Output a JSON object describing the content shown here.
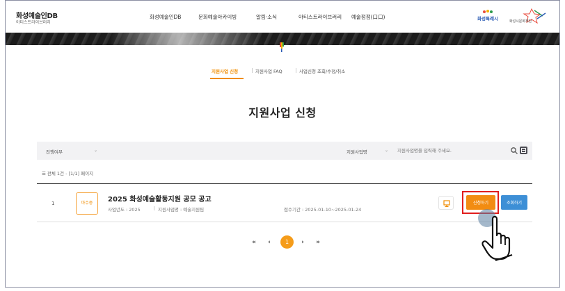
{
  "header": {
    "logo_title": "화성예술인DB",
    "logo_subtitle": "아티스트라이브러리",
    "nav": [
      "화성예술인DB",
      "문화예술아카이빙",
      "알림·소식",
      "아티스트라이브러리",
      "예술점점(口口)"
    ],
    "brand_left": "화성특례시",
    "brand_right": "화성시문화재단"
  },
  "subnav": {
    "tabs": [
      "지원사업 신청",
      "지원사업 FAQ",
      "사업신청 조회/수정/취소"
    ],
    "active_index": 0
  },
  "page_title": "지원사업 신청",
  "filter": {
    "status_label": "진행여부",
    "type_label": "지원사업명",
    "search_placeholder": "지원사업명을 입력해 주세요."
  },
  "count_text": "☰ 전체 1건 - [1/1] 페이지",
  "list": [
    {
      "num": "1",
      "status": "마수중",
      "title": "2025 화성예술활동지원 공모 공고",
      "year_label": "사업년도 : 2025",
      "field_label": "지원사업명 : 예술지원팀",
      "period": "접수기간 : 2025-01-10~2025-01-24",
      "apply_label": "신청하기",
      "lookup_label": "조회하기"
    }
  ],
  "pagination": {
    "first": "«",
    "prev": "‹",
    "current": "1",
    "next": "›",
    "last": "»"
  },
  "colors": {
    "accent": "#f08c00",
    "apply": "#f28c12",
    "lookup": "#3d8fd6",
    "highlight": "#e11d1d"
  },
  "icons": [
    "search-icon",
    "filter-icon",
    "monitor-icon",
    "hand-pointer-icon"
  ]
}
